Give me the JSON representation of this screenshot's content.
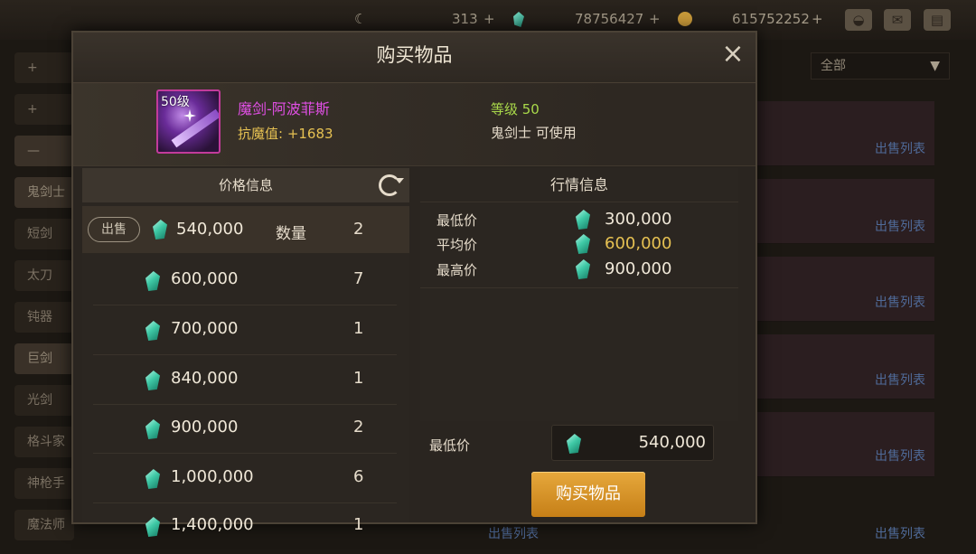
{
  "hud": {
    "currency1": "313",
    "currency2": "78756427",
    "currency3": "615752252",
    "plus": "+"
  },
  "background": {
    "left_items": [
      "+",
      "+",
      "—",
      "鬼剑士",
      "短剑",
      "太刀",
      "钝器",
      "巨剑",
      "光剑",
      "格斗家",
      "神枪手",
      "魔法师"
    ],
    "filter_label": "全部",
    "sell_list_label": "出售列表"
  },
  "modal": {
    "title": "购买物品",
    "close": "×",
    "item": {
      "level_badge": "50级",
      "name": "魔剑-阿波菲斯",
      "stat": "抗魔值: +1683",
      "req_level": "等级 50",
      "usable": "鬼剑士 可使用"
    },
    "price_panel": {
      "header": "价格信息",
      "selected": {
        "sell_label": "出售",
        "price": "540,000",
        "qty_label": "数量",
        "qty": "2"
      },
      "rows": [
        {
          "price": "600,000",
          "qty": "7"
        },
        {
          "price": "700,000",
          "qty": "1"
        },
        {
          "price": "840,000",
          "qty": "1"
        },
        {
          "price": "900,000",
          "qty": "2"
        },
        {
          "price": "1,000,000",
          "qty": "6"
        },
        {
          "price": "1,400,000",
          "qty": "1"
        }
      ]
    },
    "market_panel": {
      "header": "行情信息",
      "min_label": "最低价",
      "min_value": "300,000",
      "avg_label": "平均价",
      "avg_value": "600,000",
      "max_label": "最高价",
      "max_value": "900,000"
    },
    "purchase": {
      "lowest_label": "最低价",
      "lowest_value": "540,000",
      "buy_button": "购买物品"
    }
  },
  "colors": {
    "accent_gold": "#e6c152",
    "item_name": "#e04fe4",
    "level_green": "#a9d94a",
    "button": "#d9962a"
  }
}
